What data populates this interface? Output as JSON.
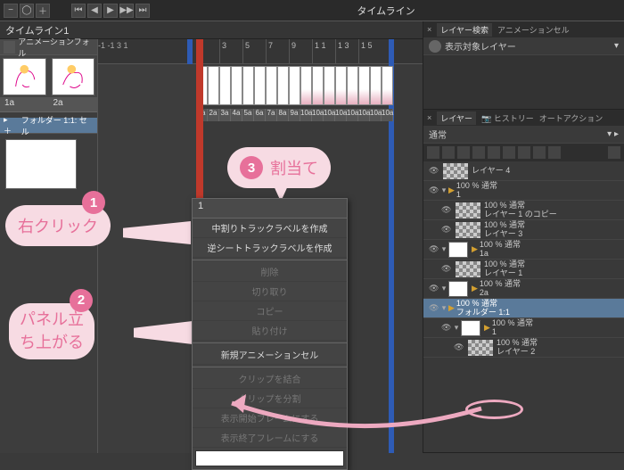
{
  "window_title": "タイムライン",
  "timeline_tab": "タイムライン1",
  "toolbar": {
    "minus": "−",
    "plus": "＋"
  },
  "ruler_neg": "-1      -1\n3        1",
  "ruler_ticks": [
    "1",
    "3",
    "5",
    "7",
    "9",
    "1\n1",
    "1\n3",
    "1\n5"
  ],
  "track_header": "アニメーションフォル",
  "cell_labels": [
    "1a",
    "2a"
  ],
  "folder_label": "フォルダー 1:1: セル",
  "frame_numbers": [
    "1a",
    "2a",
    "3a",
    "4a",
    "5a",
    "6a",
    "7a",
    "8a",
    "9a",
    "10a",
    "10a",
    "10a",
    "10a",
    "10a",
    "10a",
    "10a",
    "10a"
  ],
  "right": {
    "search_tab": "レイヤー検索",
    "animcel_tab": "アニメーションセル",
    "display_target": "表示対象レイヤー",
    "layer_tab": "レイヤー",
    "history_tab": "ヒストリー",
    "autoaction_tab": "オートアクション",
    "blend": "通常"
  },
  "layers": [
    {
      "indent": 0,
      "thumb": "chk",
      "name": "レイヤー 4",
      "op": ""
    },
    {
      "indent": 0,
      "arrow": true,
      "flag": true,
      "op": "100 % 通常",
      "name": "1"
    },
    {
      "indent": 1,
      "thumb": "chk",
      "op": "100 % 通常",
      "name": "レイヤー 1 のコピー"
    },
    {
      "indent": 1,
      "thumb": "chk",
      "op": "100 % 通常",
      "name": "レイヤー 3"
    },
    {
      "indent": 0,
      "arrow": true,
      "cthumb": true,
      "flag": true,
      "op": "100 % 通常",
      "name": "1a"
    },
    {
      "indent": 1,
      "thumb": "chk",
      "op": "100 % 通常",
      "name": "レイヤー 1"
    },
    {
      "indent": 0,
      "arrow": true,
      "cthumb": true,
      "flag": true,
      "op": "100 % 通常",
      "name": "2a"
    },
    {
      "indent": 0,
      "sel": true,
      "arrow": true,
      "flag": true,
      "op": "100 % 通常",
      "name": "フォルダー 1:1"
    },
    {
      "indent": 1,
      "arrow": true,
      "cthumb": true,
      "flag": true,
      "op": "100 % 通常",
      "name": "1",
      "hl": true
    },
    {
      "indent": 2,
      "thumb": "chk",
      "op": "100 % 通常",
      "name": "レイヤー 2"
    }
  ],
  "ctx": {
    "header": "1",
    "items": [
      {
        "label": "中割りトラックラベルを作成",
        "en": true
      },
      {
        "label": "逆シートトラックラベルを作成",
        "en": true
      },
      {
        "sep": true
      },
      {
        "label": "削除",
        "en": false
      },
      {
        "label": "切り取り",
        "en": false
      },
      {
        "label": "コピー",
        "en": false
      },
      {
        "label": "貼り付け",
        "en": false
      },
      {
        "sep": true
      },
      {
        "label": "新規アニメーションセル",
        "en": true
      },
      {
        "sep": true
      },
      {
        "label": "クリップを結合",
        "en": false
      },
      {
        "label": "クリップを分割",
        "en": false
      },
      {
        "label": "表示開始フレームにする",
        "en": false
      },
      {
        "label": "表示終了フレームにする",
        "en": false
      }
    ],
    "input_value": ""
  },
  "annotations": {
    "b1": "右クリック",
    "b2a": "パネル立",
    "b2b": "ち上がる",
    "b3": "割当て",
    "n1": "1",
    "n2": "2",
    "n3": "3"
  }
}
